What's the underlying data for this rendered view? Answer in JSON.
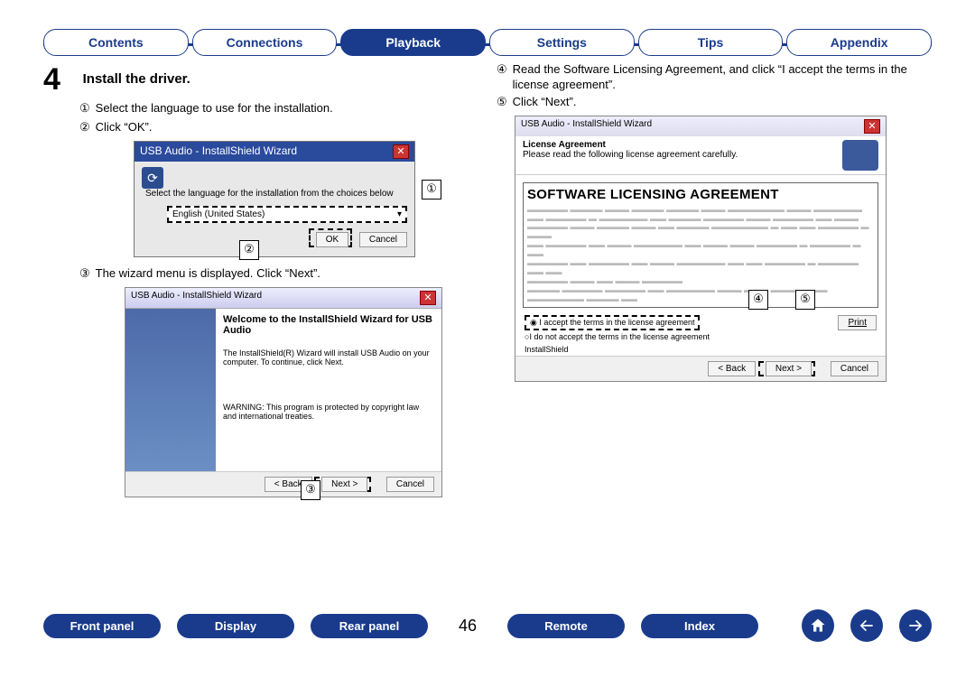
{
  "tabs": {
    "contents": "Contents",
    "connections": "Connections",
    "playback": "Playback",
    "settings": "Settings",
    "tips": "Tips",
    "appendix": "Appendix"
  },
  "step": {
    "number": "4",
    "title": "Install the driver."
  },
  "left": {
    "s1": "Select the language to use for the installation.",
    "s2": "Click “OK”.",
    "s3": "The wizard menu is displayed. Click “Next”."
  },
  "right": {
    "s4": "Read the Software Licensing Agreement, and click “I accept the terms in the license agreement”.",
    "s5": "Click “Next”."
  },
  "circled": {
    "c1": "①",
    "c2": "②",
    "c3": "③",
    "c4": "④",
    "c5": "⑤"
  },
  "dlg1": {
    "title": "USB Audio - InstallShield Wizard",
    "prompt": "Select the language for the installation from the choices below",
    "lang": "English (United States)",
    "ok": "OK",
    "cancel": "Cancel"
  },
  "dlg2": {
    "title": "USB Audio - InstallShield Wizard",
    "welcome": "Welcome to the InstallShield Wizard for USB Audio",
    "body1": "The InstallShield(R) Wizard will install USB Audio on your computer. To continue, click Next.",
    "body2": "WARNING: This program is protected by copyright law and international treaties.",
    "back": "< Back",
    "next": "Next >",
    "cancel": "Cancel"
  },
  "dlg3": {
    "title": "USB Audio - InstallShield Wizard",
    "header_bold": "License Agreement",
    "header_sub": "Please read the following license agreement carefully.",
    "sla": "SOFTWARE LICENSING AGREEMENT",
    "accept": "I accept the terms in the license agreement",
    "reject": "I do not accept the terms in the license agreement",
    "print": "Print",
    "installshield": "InstallShield",
    "back": "< Back",
    "next": "Next >",
    "cancel": "Cancel"
  },
  "bottom": {
    "front": "Front panel",
    "display": "Display",
    "rear": "Rear panel",
    "page": "46",
    "remote": "Remote",
    "index": "Index"
  }
}
